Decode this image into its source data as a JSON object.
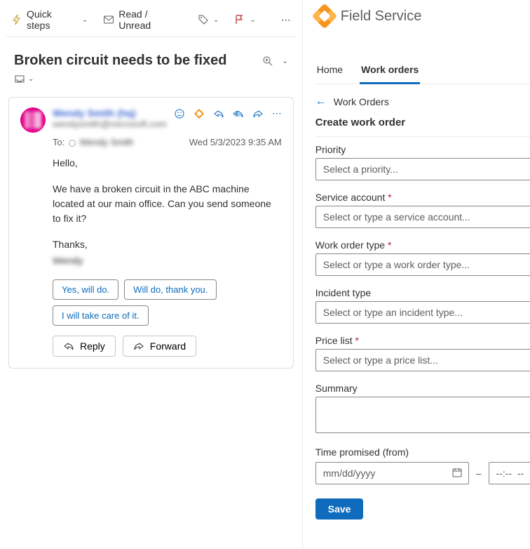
{
  "toolbar": {
    "quick_steps": "Quick steps",
    "read_unread": "Read / Unread"
  },
  "email": {
    "subject": "Broken circuit needs to be fixed",
    "sender_name": "Wendy Smith (hq)",
    "sender_email": "wendysmith@microsoft.com",
    "to_label": "To:",
    "to_name": "Wendy Smith",
    "timestamp": "Wed 5/3/2023 9:35 AM",
    "body_greeting": "Hello,",
    "body_main": "We have a broken circuit in the ABC machine located at   our main office. Can you send someone to fix it?",
    "body_signoff": "Thanks,",
    "body_sig_name": "Wendy",
    "quick_replies": [
      "Yes, will do.",
      "Will do, thank you.",
      "I will take care of it."
    ],
    "reply_label": "Reply",
    "forward_label": "Forward"
  },
  "fs": {
    "app_title": "Field Service",
    "tabs": {
      "home": "Home",
      "work_orders": "Work orders"
    },
    "breadcrumb": "Work Orders",
    "page_title": "Create work order",
    "fields": {
      "priority": {
        "label": "Priority",
        "placeholder": "Select a priority..."
      },
      "service_account": {
        "label": "Service account",
        "placeholder": "Select or type a service account..."
      },
      "work_order_type": {
        "label": "Work order type",
        "placeholder": "Select or type a work order type..."
      },
      "incident_type": {
        "label": "Incident type",
        "placeholder": "Select or type an incident type..."
      },
      "price_list": {
        "label": "Price list",
        "placeholder": "Select or type a price list..."
      },
      "summary": {
        "label": "Summary"
      },
      "time_promised": {
        "label": "Time promised (from)",
        "date_placeholder": "mm/dd/yyyy",
        "time_placeholder": "--:--  --"
      }
    },
    "save_label": "Save",
    "required_mark": "*"
  }
}
